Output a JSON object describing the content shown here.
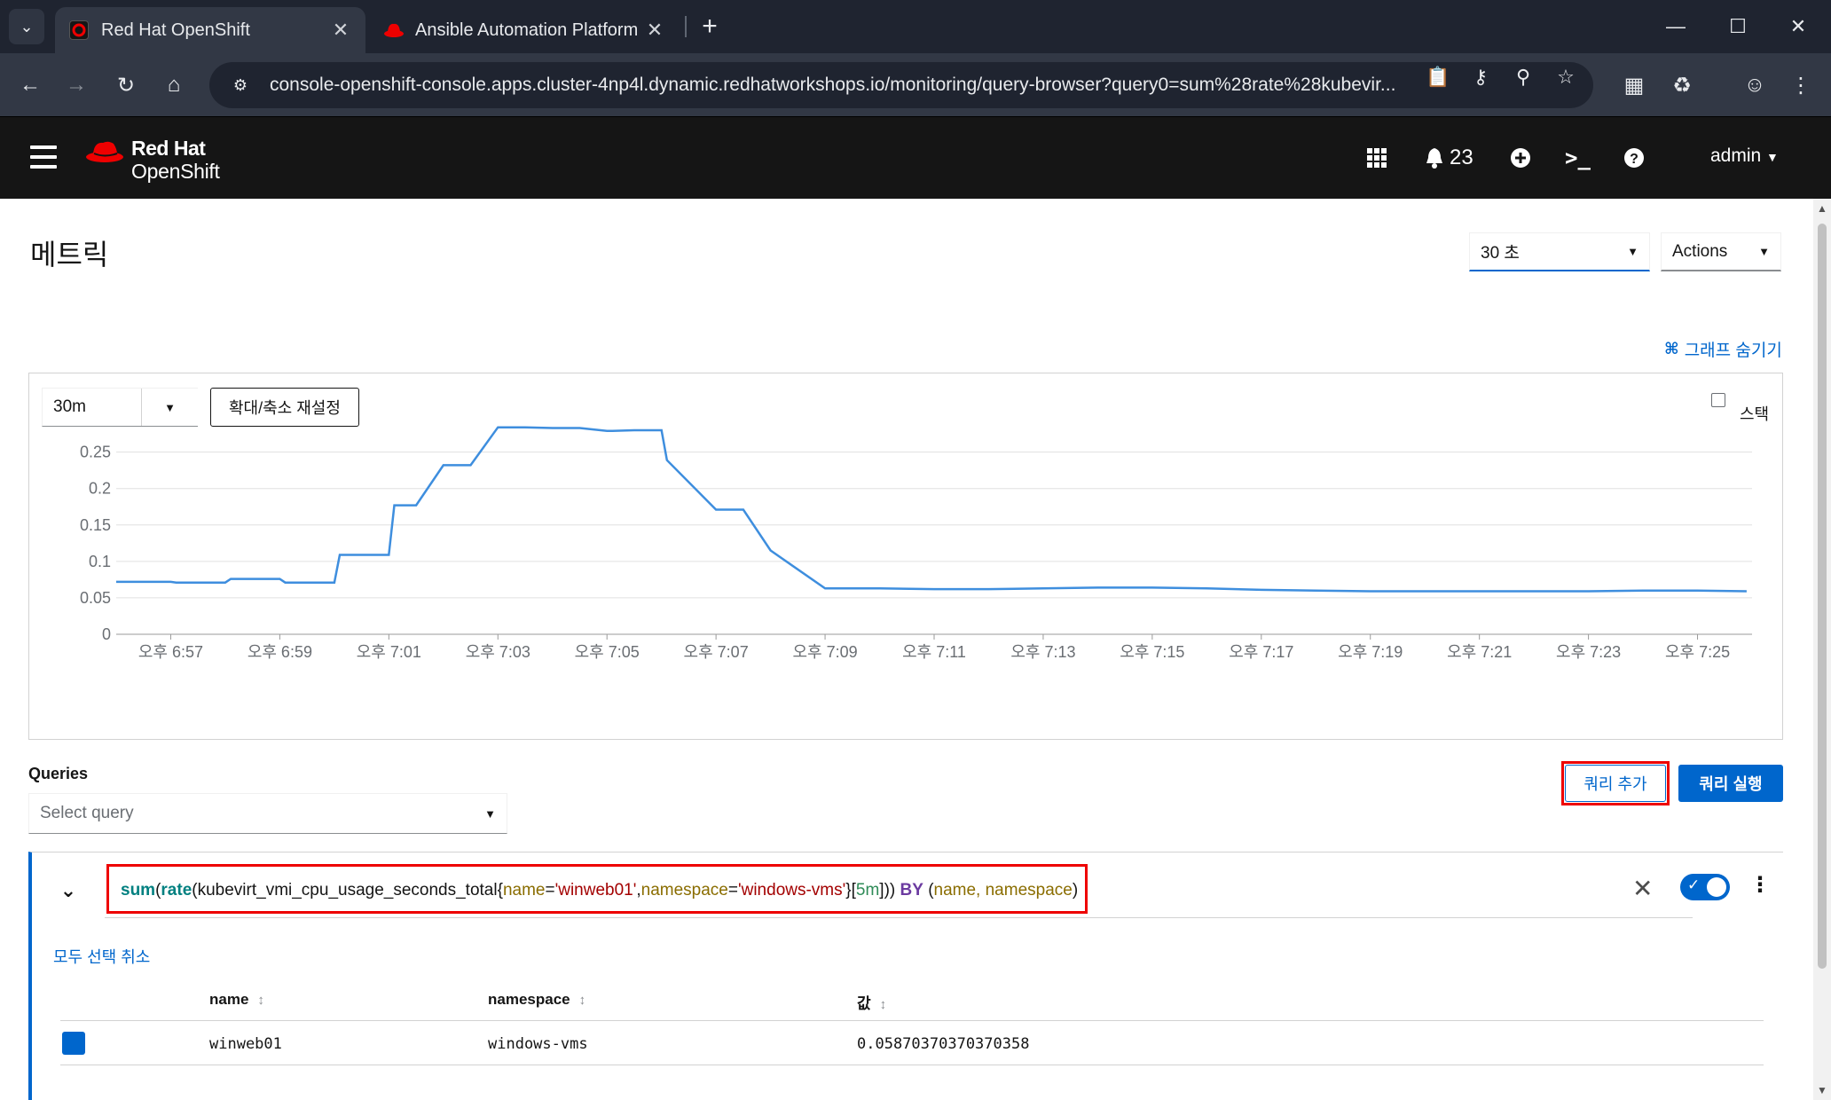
{
  "browser": {
    "tabs": [
      {
        "title": "Red Hat OpenShift",
        "active": true
      },
      {
        "title": "Ansible Automation Platform",
        "active": false
      }
    ],
    "url": "console-openshift-console.apps.cluster-4np4l.dynamic.redhatworkshops.io/monitoring/query-browser?query0=sum%28rate%28kubevir..."
  },
  "masthead": {
    "brand_line1": "Red Hat",
    "brand_line2": "OpenShift",
    "notification_count": "23",
    "user": "admin"
  },
  "page": {
    "title": "메트릭",
    "refresh_interval": "30 초",
    "actions_label": "Actions",
    "hide_graph_label": "그래프 숨기기"
  },
  "graph": {
    "time_range": "30m",
    "reset_zoom_label": "확대/축소 재설정",
    "stack_label": "스택",
    "stack_checked": false,
    "series_color": "#3e8ede"
  },
  "chart_data": {
    "type": "line",
    "title": "",
    "xlabel": "",
    "ylabel": "",
    "ylim": [
      0,
      0.28
    ],
    "yticks": [
      "0",
      "0.05",
      "0.1",
      "0.15",
      "0.2",
      "0.25"
    ],
    "xticks": [
      "오후 6:57",
      "오후 6:59",
      "오후 7:01",
      "오후 7:03",
      "오후 7:05",
      "오후 7:07",
      "오후 7:09",
      "오후 7:11",
      "오후 7:13",
      "오후 7:15",
      "오후 7:17",
      "오후 7:19",
      "오후 7:21",
      "오후 7:23",
      "오후 7:25"
    ],
    "grid": true,
    "series": [
      {
        "x": [
          0.0,
          0.5,
          1.0,
          1.1,
          1.5,
          2.0,
          2.1,
          2.5,
          3.0,
          3.1,
          3.5,
          4.0,
          4.1,
          4.5,
          5.0,
          5.1,
          5.5,
          6.0,
          6.5,
          7.0,
          7.5,
          8.0,
          8.1,
          8.5,
          9.0,
          9.1,
          9.5,
          10.0,
          10.1,
          11.0,
          11.5,
          12.0,
          13.0,
          14.0,
          15.0,
          15.5,
          16.0,
          17.0,
          18.0,
          19.0,
          20.0,
          21.0,
          22.0,
          23.0,
          24.0,
          25.0,
          26.0,
          27.0,
          28.0,
          29.0,
          29.9
        ],
        "values": [
          0.072,
          0.072,
          0.072,
          0.071,
          0.071,
          0.071,
          0.076,
          0.076,
          0.076,
          0.071,
          0.071,
          0.071,
          0.109,
          0.109,
          0.109,
          0.177,
          0.177,
          0.232,
          0.232,
          0.284,
          0.284,
          0.283,
          0.283,
          0.283,
          0.279,
          0.279,
          0.28,
          0.28,
          0.239,
          0.171,
          0.171,
          0.115,
          0.063,
          0.063,
          0.062,
          0.062,
          0.062,
          0.063,
          0.064,
          0.064,
          0.063,
          0.061,
          0.06,
          0.059,
          0.059,
          0.059,
          0.059,
          0.059,
          0.06,
          0.06,
          0.059
        ]
      }
    ]
  },
  "queries": {
    "label": "Queries",
    "select_placeholder": "Select query",
    "add_query_label": "쿼리 추가",
    "run_queries_label": "쿼리 실행",
    "expression": {
      "sum": "sum",
      "rate": "rate",
      "metric": "kubevirt_vmi_cpu_usage_seconds_total",
      "label1_key": "name",
      "label1_val": "'winweb01'",
      "label2_key": "namespace",
      "label2_val": "'windows-vms'",
      "range": "5m",
      "by": "BY",
      "by_labels": "name, namespace"
    },
    "unselect_all_label": "모두 선택 취소",
    "table": {
      "columns": [
        "name",
        "namespace",
        "값"
      ],
      "rows": [
        {
          "name": "winweb01",
          "namespace": "windows-vms",
          "value": "0.05870370370370358"
        }
      ]
    }
  }
}
